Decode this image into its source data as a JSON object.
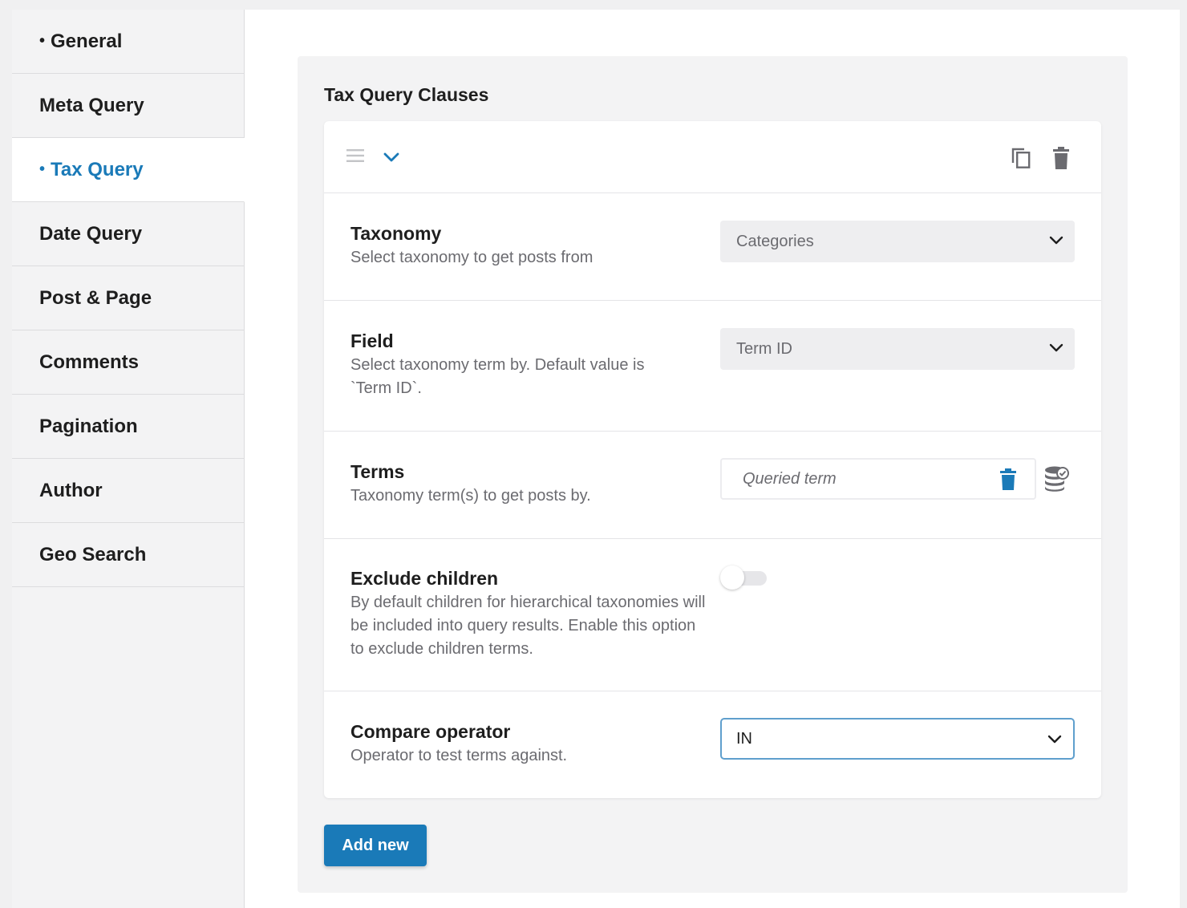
{
  "sidebar": {
    "items": [
      {
        "label": "General",
        "bullet": "•"
      },
      {
        "label": "Meta Query"
      },
      {
        "label": "Tax Query",
        "bullet": "•",
        "active": true
      },
      {
        "label": "Date Query"
      },
      {
        "label": "Post & Page"
      },
      {
        "label": "Comments"
      },
      {
        "label": "Pagination"
      },
      {
        "label": "Author"
      },
      {
        "label": "Geo Search"
      }
    ]
  },
  "panel": {
    "title": "Tax Query Clauses",
    "add_button_label": "Add new"
  },
  "clause": {
    "header_icons": [
      "drag-handle-icon",
      "chevron-down-icon",
      "copy-icon",
      "trash-icon"
    ],
    "taxonomy": {
      "label": "Taxonomy",
      "description": "Select taxonomy to get posts from",
      "value": "Categories"
    },
    "field": {
      "label": "Field",
      "description": "Select taxonomy term by. Default value is `Term ID`.",
      "value": "Term ID"
    },
    "terms": {
      "label": "Terms",
      "description": "Taxonomy term(s) to get posts by.",
      "value": "Queried term"
    },
    "exclude_children": {
      "label": "Exclude children",
      "description": "By default children for hierarchical taxonomies will be included into query results. Enable this option to exclude children terms.",
      "enabled": false
    },
    "compare_operator": {
      "label": "Compare operator",
      "description": "Operator to test terms against.",
      "value": "IN"
    }
  },
  "colors": {
    "accent": "#1a7ab8",
    "focus_border": "#5f9fcd",
    "sidebar_bg": "#f3f3f4",
    "muted_text": "#6b6b70"
  }
}
